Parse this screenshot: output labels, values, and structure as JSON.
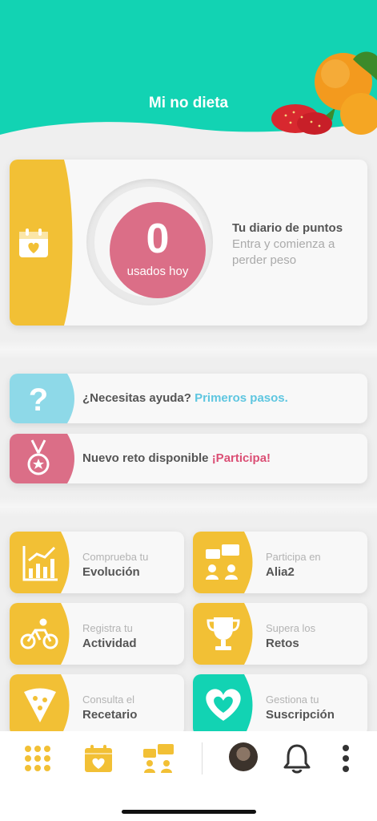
{
  "colors": {
    "teal": "#12d3b3",
    "yellow": "#f2c035",
    "pink": "#db6e87",
    "light_blue": "#8ed9e8",
    "text_dark": "#555555",
    "text_light": "#b3b3b3"
  },
  "header": {
    "title": "Mi no dieta"
  },
  "diary": {
    "icon": "calendar-heart-icon",
    "points_value": "0",
    "points_label": "usados hoy",
    "title": "Tu diario de puntos",
    "description": "Entra y comienza a perder peso"
  },
  "help_banner": {
    "icon": "question-icon",
    "text": "¿Necesitas ayuda?",
    "link": "Primeros pasos."
  },
  "challenge_banner": {
    "icon": "medal-icon",
    "text": "Nuevo reto disponible",
    "link": "¡Participa!"
  },
  "tiles": [
    {
      "icon": "chart-icon",
      "small": "Comprueba tu",
      "big": "Evolución"
    },
    {
      "icon": "chat-icon",
      "small": "Participa en",
      "big": "Alia2"
    },
    {
      "icon": "bike-icon",
      "small": "Registra tu",
      "big": "Actividad"
    },
    {
      "icon": "trophy-icon",
      "small": "Supera los",
      "big": "Retos"
    },
    {
      "icon": "pizza-icon",
      "small": "Consulta el",
      "big": "Recetario"
    },
    {
      "icon": "heart-icon",
      "small": "Gestiona tu",
      "big": "Suscripción"
    }
  ],
  "tabbar": {
    "items": [
      "grid-icon",
      "calendar-heart-icon",
      "chat-icon",
      "avatar",
      "bell-icon",
      "more-icon"
    ]
  }
}
